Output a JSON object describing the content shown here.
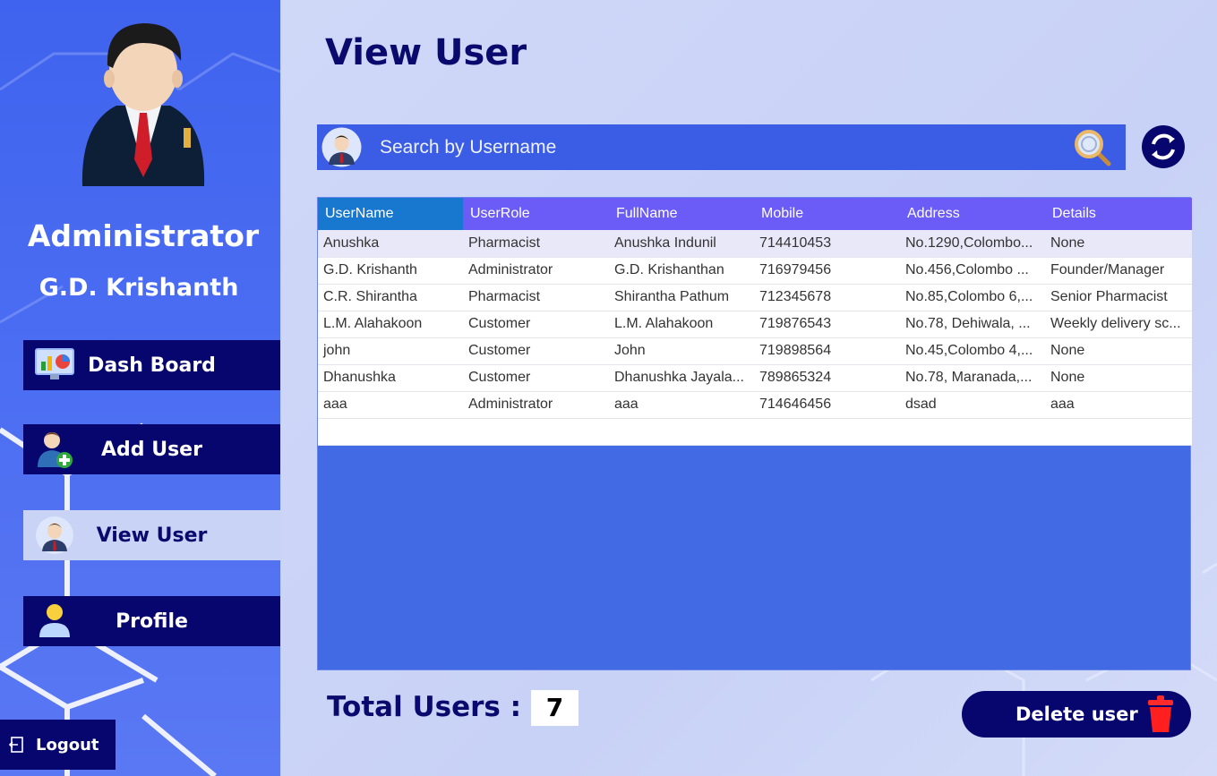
{
  "sidebar": {
    "role": "Administrator",
    "name": "G.D. Krishanth",
    "items": [
      {
        "label": "Dash Board",
        "icon": "dashboard-chart-icon"
      },
      {
        "label": "Add User",
        "icon": "add-user-icon"
      },
      {
        "label": "View User",
        "icon": "user-icon",
        "active": true
      },
      {
        "label": "Profile",
        "icon": "profile-icon"
      }
    ],
    "logout_label": "Logout"
  },
  "main": {
    "title": "View User",
    "search": {
      "placeholder": "Search by Username"
    },
    "table": {
      "columns": [
        "UserName",
        "UserRole",
        "FullName",
        "Mobile",
        "Address",
        "Details"
      ],
      "rows": [
        [
          "Anushka",
          "Pharmacist",
          "Anushka Indunil",
          "714410453",
          "No.1290,Colombo...",
          "None"
        ],
        [
          "G.D. Krishanth",
          "Administrator",
          "G.D. Krishanthan",
          "716979456",
          "No.456,Colombo ...",
          "Founder/Manager"
        ],
        [
          "C.R. Shirantha",
          "Pharmacist",
          "Shirantha Pathum",
          "712345678",
          "No.85,Colombo 6,...",
          "Senior Pharmacist"
        ],
        [
          "L.M. Alahakoon",
          "Customer",
          "L.M. Alahakoon",
          "719876543",
          "No.78, Dehiwala, ...",
          "Weekly delivery sc..."
        ],
        [
          "john",
          "Customer",
          "John",
          "719898564",
          "No.45,Colombo 4,...",
          "None"
        ],
        [
          "Dhanushka",
          "Customer",
          "Dhanushka Jayala...",
          "789865324",
          "No.78, Maranada,...",
          "None"
        ],
        [
          "aaa",
          "Administrator",
          "aaa",
          "714646456",
          "dsad",
          "aaa"
        ]
      ]
    },
    "total_label": "Total Users :",
    "total_value": "7",
    "delete_label": "Delete user"
  },
  "colors": {
    "sidebar": "#4b6df2",
    "nav_button": "#06066e",
    "header_row": "#6b5cf7",
    "header_selected": "#1877cf",
    "table_area": "#426ae4",
    "title_text": "#0a0a6e"
  }
}
